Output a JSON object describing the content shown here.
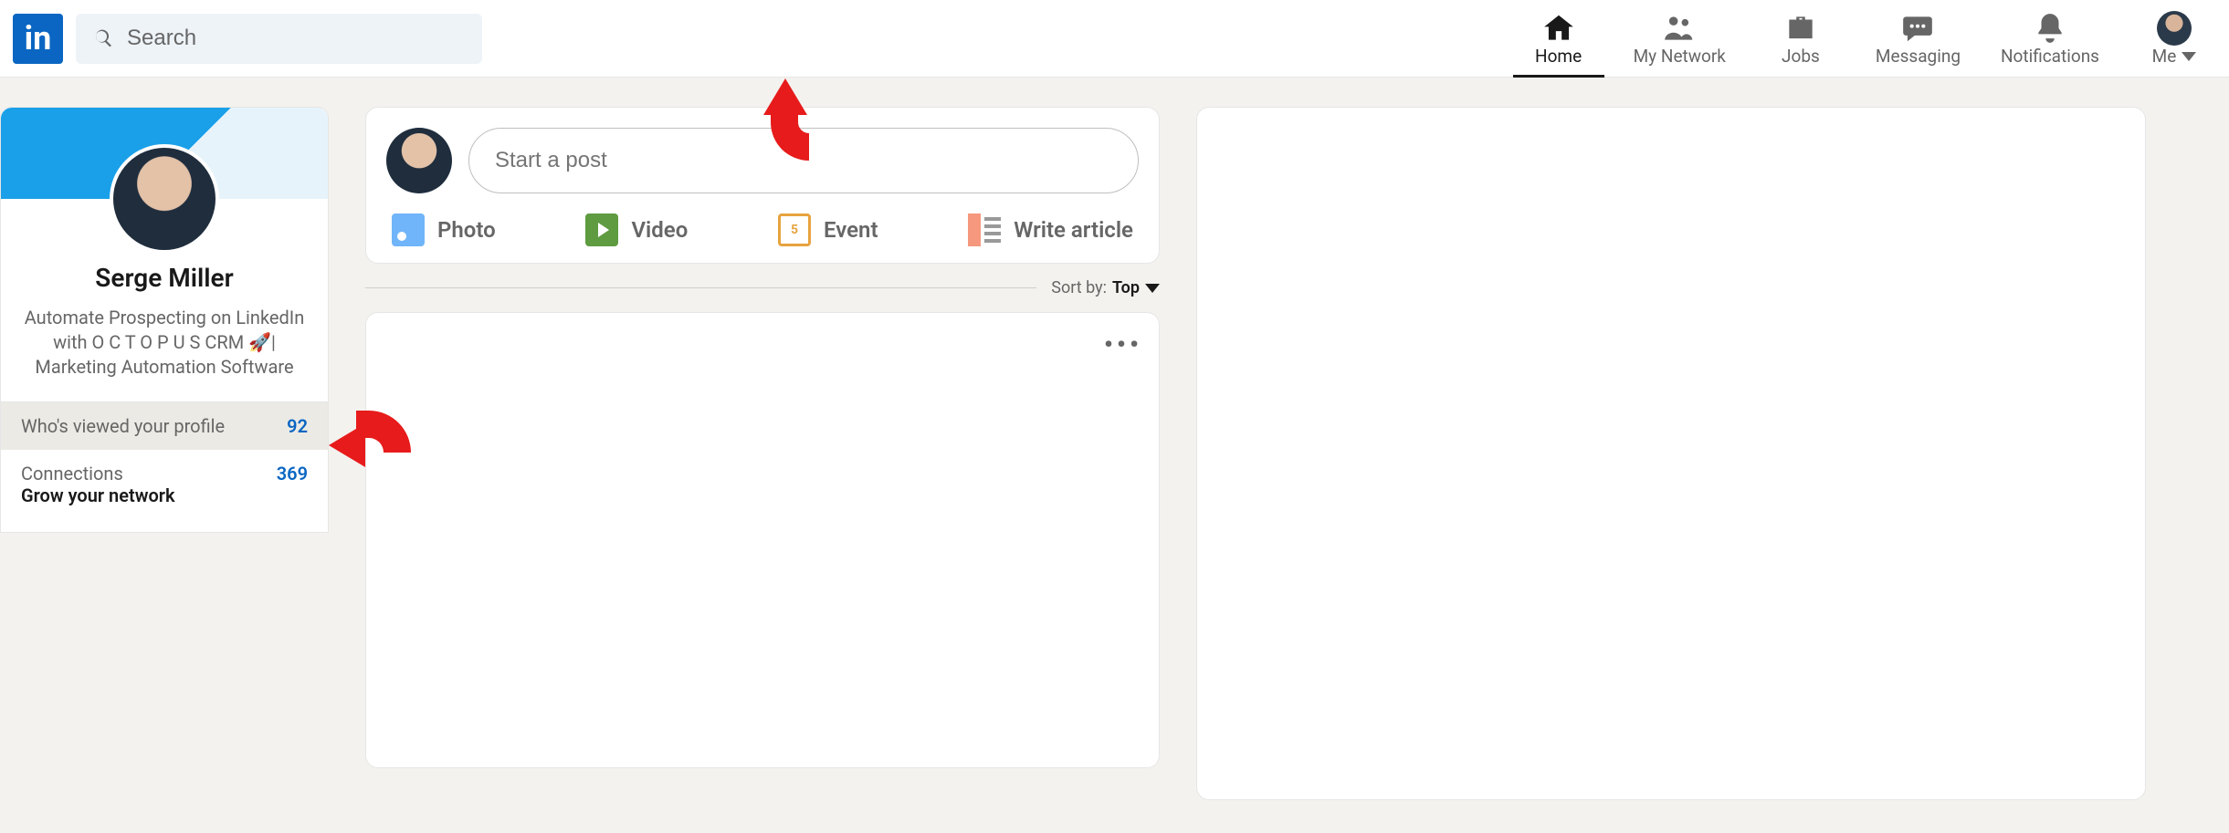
{
  "logo_text": "in",
  "search": {
    "placeholder": "Search"
  },
  "nav": [
    {
      "key": "home",
      "label": "Home",
      "active": true
    },
    {
      "key": "network",
      "label": "My Network",
      "active": false
    },
    {
      "key": "jobs",
      "label": "Jobs",
      "active": false
    },
    {
      "key": "messaging",
      "label": "Messaging",
      "active": false
    },
    {
      "key": "notifications",
      "label": "Notifications",
      "active": false
    },
    {
      "key": "me",
      "label": "Me",
      "active": false
    }
  ],
  "profile": {
    "name": "Serge Miller",
    "headline": "Automate Prospecting on LinkedIn with O C T O P U S CRM 🚀| Marketing Automation Software",
    "stats": {
      "viewed_label": "Who's viewed your profile",
      "viewed_count": "92",
      "connections_label": "Connections",
      "connections_count": "369",
      "grow_label": "Grow your network"
    }
  },
  "compose": {
    "placeholder": "Start a post",
    "actions": {
      "photo": "Photo",
      "video": "Video",
      "event": "Event",
      "article": "Write article"
    }
  },
  "sort": {
    "prefix": "Sort by:",
    "value": "Top"
  },
  "feed": {
    "menu": "•••"
  }
}
